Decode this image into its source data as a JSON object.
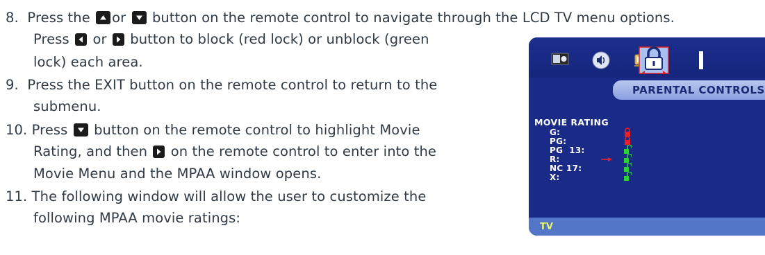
{
  "steps": [
    {
      "number": "8.",
      "text_a": "Press the",
      "text_b": "or",
      "text_c": "button on the remote control to navigate through the LCD TV menu options.",
      "line2_a": "Press",
      "line2_b": "or",
      "line2_c": "button to block (red lock) or unblock (green",
      "line3": "lock) each area."
    },
    {
      "number": "9.",
      "line1": "Press the EXIT button on the remote control to return to the",
      "line2": "submenu."
    },
    {
      "number": "10.",
      "line1_a": "Press",
      "line1_b": "button on the remote control to highlight Movie",
      "line2_a": "Rating, and then",
      "line2_b": "on the remote control to enter into the",
      "line3": "Movie Menu and the MPAA window opens."
    },
    {
      "number": "11.",
      "line1": "The following window will allow the user to customize the",
      "line2": "following MPAA movie ratings:"
    }
  ],
  "tv_menu": {
    "tab_icons": [
      "picture-icon",
      "audio-icon",
      "tv-icon",
      "lock-icon"
    ],
    "section_title": "PARENTAL CONTROLS",
    "movie_rating_title": "MOVIE RATING",
    "ratings": [
      {
        "label": "G:",
        "lock": "red-locked"
      },
      {
        "label": "PG:",
        "lock": "red-locked"
      },
      {
        "label": "PG  13:",
        "lock": "green-unlocked"
      },
      {
        "label": "R:",
        "lock": "green-unlocked"
      },
      {
        "label": "NC 17:",
        "lock": "green-unlocked"
      },
      {
        "label": "X:",
        "lock": "green-unlocked"
      }
    ],
    "footer": "TV",
    "colors": {
      "background": "#1a2b87",
      "header_bar": "#a7b7e8",
      "footer_bar": "#5476c8",
      "locked": "#e8202a",
      "unlocked": "#2bd03a",
      "footer_text": "#e6f46a"
    }
  }
}
